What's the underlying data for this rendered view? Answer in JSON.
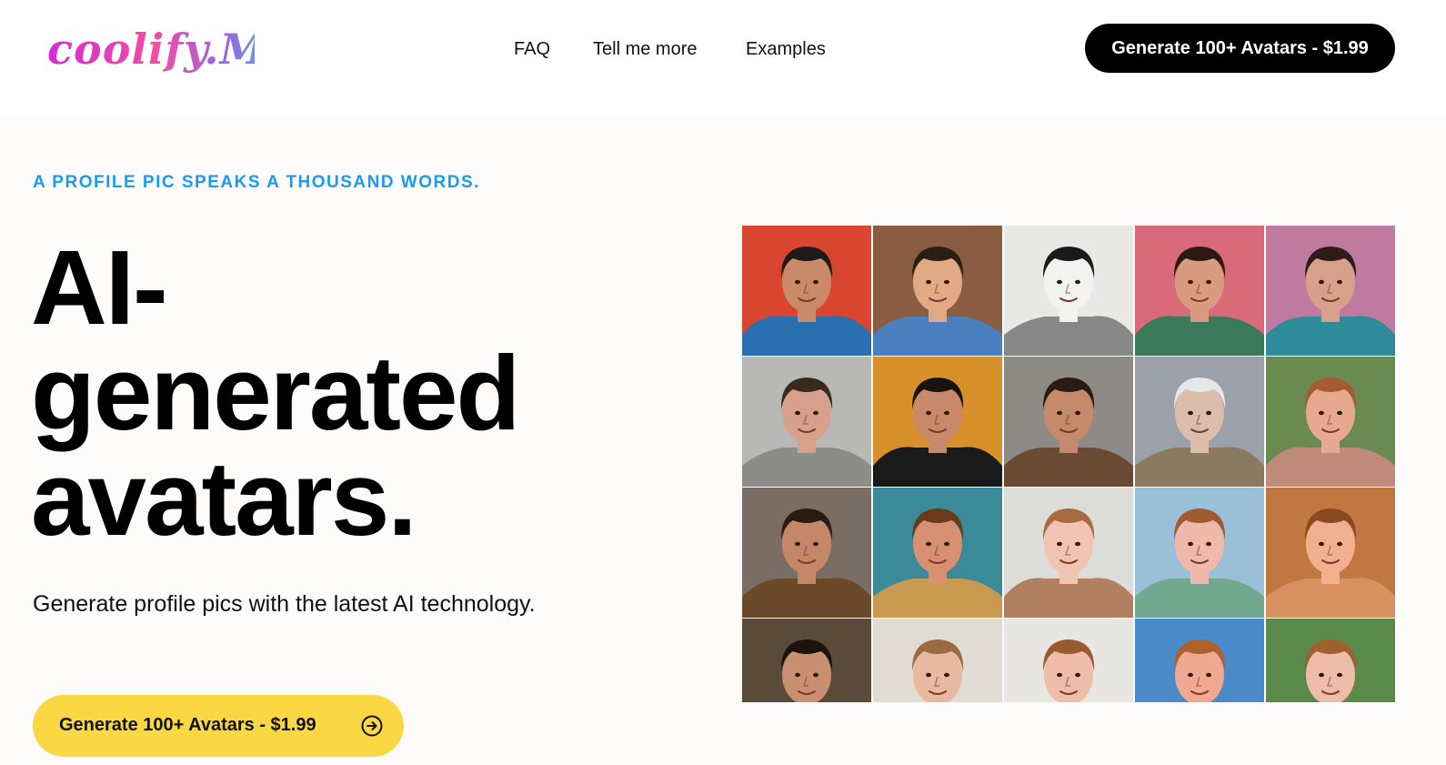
{
  "header": {
    "logo_text": "coolify.Me",
    "nav": [
      "FAQ",
      "Tell me more",
      "Examples"
    ],
    "cta_label": "Generate 100+ Avatars - $1.99"
  },
  "hero": {
    "eyebrow": "A PROFILE PIC SPEAKS A THOUSAND WORDS.",
    "headline_lines": [
      "AI-",
      "generated",
      "avatars."
    ],
    "subtitle": "Generate profile pics with the latest AI technology.",
    "cta_label": "Generate 100+ Avatars - $1.99",
    "cta_icon": "arrow-right-circle-icon"
  },
  "colors": {
    "eyebrow": "#1a9af0",
    "header_cta_bg": "#000000",
    "main_cta_bg": "#fad844",
    "page_bg": "#fcfbf9"
  },
  "avatar_grid": {
    "tiles": [
      {
        "style": "geometric-pop-art",
        "bg": "#d9452e",
        "accent": "#2a6fb0",
        "skin": "#c98a6a",
        "hair": "#1c1c1c"
      },
      {
        "style": "bobblehead-figurine",
        "bg": "#8a5d43",
        "accent": "#4a80c0",
        "skin": "#e2a985",
        "hair": "#2b1d14"
      },
      {
        "style": "pencil-sketch",
        "bg": "#e8e8e6",
        "accent": "#888888",
        "skin": "#f2f2f0",
        "hair": "#1a1a1a"
      },
      {
        "style": "floral-portrait",
        "bg": "#d86a7a",
        "accent": "#3a7a5a",
        "skin": "#d99a80",
        "hair": "#2a1a12"
      },
      {
        "style": "floral-pattern-shirt",
        "bg": "#c07aa0",
        "accent": "#2e8c9a",
        "skin": "#d8a08a",
        "hair": "#2c1e16"
      },
      {
        "style": "photo-realistic",
        "bg": "#b8b8b6",
        "accent": "#8c8c88",
        "skin": "#d6a08a",
        "hair": "#3a2a1e"
      },
      {
        "style": "art-deco-tuxedo",
        "bg": "#d8902a",
        "accent": "#1a1a1a",
        "skin": "#c8886a",
        "hair": "#1a120c"
      },
      {
        "style": "warrior",
        "bg": "#8e8a86",
        "accent": "#6a4a32",
        "skin": "#c48a6a",
        "hair": "#2a1c12"
      },
      {
        "style": "elf-fantasy",
        "bg": "#9ca0a8",
        "accent": "#8a7a60",
        "skin": "#dcbcaa",
        "hair": "#e6e6e8"
      },
      {
        "style": "pixar-style",
        "bg": "#6a8a52",
        "accent": "#c08a7a",
        "skin": "#e8a890",
        "hair": "#a85a32"
      },
      {
        "style": "steampunk",
        "bg": "#7a6e64",
        "accent": "#6a4a2a",
        "skin": "#c48868",
        "hair": "#2a1c12"
      },
      {
        "style": "painterly-van-gogh",
        "bg": "#3a8a9a",
        "accent": "#c89a50",
        "skin": "#d89070",
        "hair": "#6a3a1a"
      },
      {
        "style": "soft-portrait",
        "bg": "#dcdcd8",
        "accent": "#b08060",
        "skin": "#f0c4b0",
        "hair": "#a86a40"
      },
      {
        "style": "fairy",
        "bg": "#9ac0d8",
        "accent": "#70a890",
        "skin": "#f0b8a8",
        "hair": "#a05a30"
      },
      {
        "style": "warm-painted",
        "bg": "#c07840",
        "accent": "#d89060",
        "skin": "#f0b090",
        "hair": "#8a4a20"
      },
      {
        "style": "industrial",
        "bg": "#5a4a3a",
        "accent": "#8a7a60",
        "skin": "#c89070",
        "hair": "#1c140c"
      },
      {
        "style": "renaissance",
        "bg": "#e0dcd4",
        "accent": "#3a4a5a",
        "skin": "#e8b8a0",
        "hair": "#9a6a40"
      },
      {
        "style": "portrait",
        "bg": "#e8e6e2",
        "accent": "#c8a890",
        "skin": "#eebca8",
        "hair": "#9a5a30"
      },
      {
        "style": "beach",
        "bg": "#4a8ac8",
        "accent": "#2a5a9a",
        "skin": "#f0a890",
        "hair": "#b0602a"
      },
      {
        "style": "flower-crown",
        "bg": "#5a8a4a",
        "accent": "#e8a0c0",
        "skin": "#eebca8",
        "hair": "#a06030"
      }
    ]
  }
}
